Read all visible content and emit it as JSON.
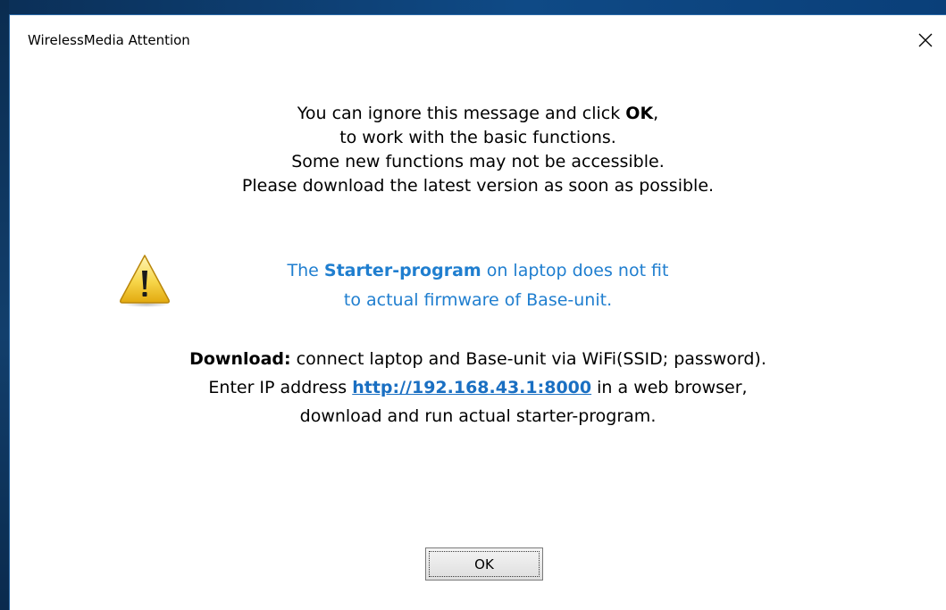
{
  "window": {
    "title": "WirelessMedia Attention"
  },
  "message": {
    "line1_pre": "You can ignore this message and click ",
    "line1_bold": "OK",
    "line1_post": ",",
    "line2": "to work with the basic functions.",
    "line3": "Some new functions may not be accessible.",
    "line4": "Please download the latest version as soon as possible."
  },
  "warning": {
    "icon": "warning-triangle-icon",
    "line1_pre": "The ",
    "line1_bold": "Starter-program",
    "line1_post": " on laptop does not fit",
    "line2": "to actual firmware of Base-unit."
  },
  "download": {
    "line1_bold": "Download:",
    "line1_rest": " connect laptop and Base-unit via WiFi(SSID; password).",
    "line2_pre": "Enter IP address ",
    "line2_link": "http://192.168.43.1:8000",
    "line2_post": " in a web browser,",
    "line3": "download and run actual starter-program."
  },
  "buttons": {
    "ok_label": "OK"
  },
  "colors": {
    "warning_text": "#1f7ecf",
    "link": "#1a6fc2",
    "desktop": "#0d3a6b"
  }
}
